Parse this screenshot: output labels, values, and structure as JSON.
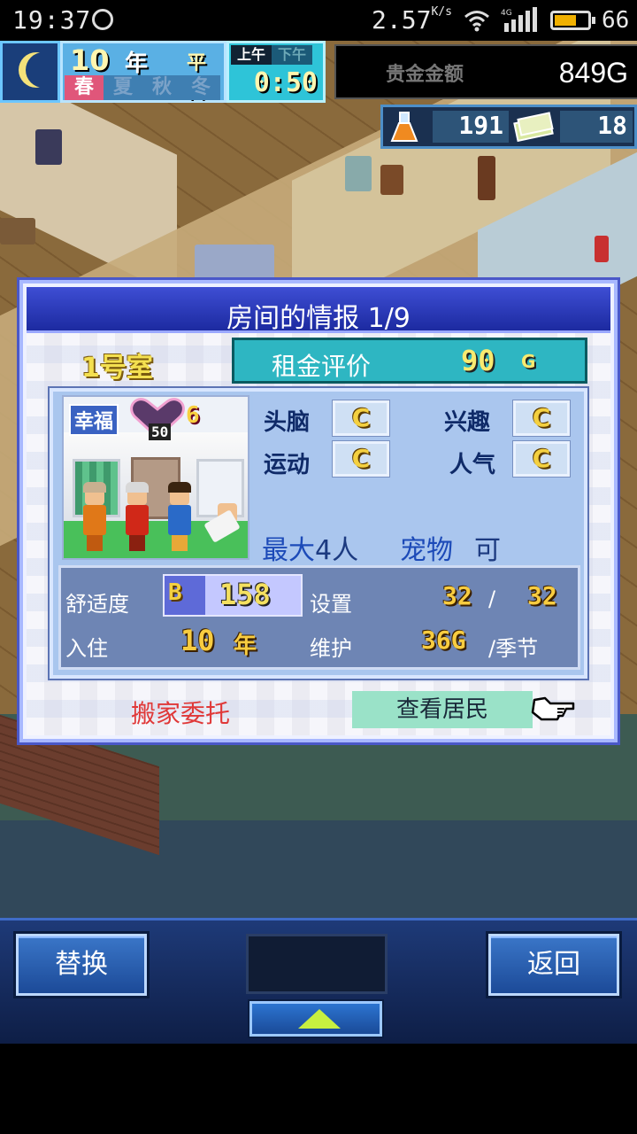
{
  "status_bar": {
    "time": "19:37",
    "net_speed": "2.57",
    "net_unit": "K/s",
    "signal_label": "4G",
    "battery_level": 0.66,
    "battery_text": "66"
  },
  "hud": {
    "year_number": "10",
    "year_unit": "年",
    "weekday": "平日",
    "seasons": [
      "春",
      "夏",
      "秋",
      "冬"
    ],
    "active_season_index": 0,
    "am_label": "上午",
    "pm_label": "下午",
    "clock": "0:50",
    "money_label": "贵金金额",
    "money_value": "849G",
    "research_points": "191",
    "tickets": "18"
  },
  "dialog": {
    "title": "房间的情报 1/9",
    "room_name": "1号室",
    "rent_label": "租金评价",
    "rent_value": "90",
    "rent_unit": "G",
    "happy_label": "幸福",
    "heart_number": "50",
    "happy_value": "6",
    "attributes": [
      {
        "label": "头脑",
        "grade": "C"
      },
      {
        "label": "兴趣",
        "grade": "C"
      },
      {
        "label": "运动",
        "grade": "C"
      },
      {
        "label": "人气",
        "grade": "C"
      }
    ],
    "max_label": "最大",
    "max_value": "4人",
    "pet_label": "宠物",
    "pet_value": "可",
    "comfort_label": "舒适度",
    "comfort_grade": "B",
    "comfort_value": "158",
    "setting_label": "设置",
    "setting_current": "32",
    "setting_slash": "/",
    "setting_max": "32",
    "residence_label": "入住",
    "residence_value": "10",
    "residence_unit": "年",
    "maintenance_label": "维护",
    "maintenance_value": "36G",
    "maintenance_unit": "/季节",
    "move_out_label": "搬家委托",
    "view_residents_label": "查看居民"
  },
  "bottom": {
    "swap_label": "替换",
    "back_label": "返回"
  },
  "colors": {
    "dialog_title_bar": "#1c2aa0",
    "rent_box": "#2eb6c2",
    "move_link": "#e03838",
    "view_button": "#9ae2c8"
  }
}
